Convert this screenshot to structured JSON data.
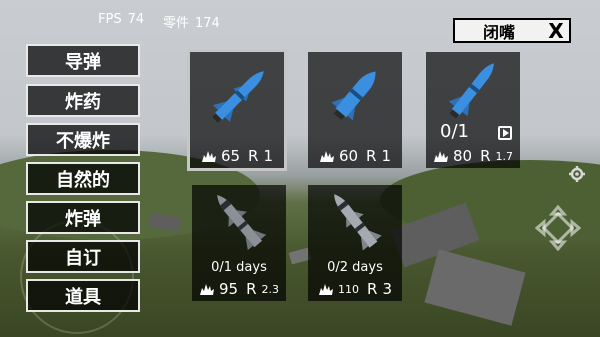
{
  "hud": {
    "fps_label": "FPS",
    "fps_value": "74",
    "parts_label": "零件",
    "parts_value": "174"
  },
  "categories": [
    {
      "label": "导弹",
      "active": false
    },
    {
      "label": "炸药",
      "active": false
    },
    {
      "label": "不爆炸",
      "active": false
    },
    {
      "label": "自然的",
      "active": false
    },
    {
      "label": "炸弹",
      "active": false
    },
    {
      "label": "自订",
      "active": false
    },
    {
      "label": "道具",
      "active": false
    }
  ],
  "close_bar": {
    "label": "闭嘴",
    "close_glyph": "X"
  },
  "weapons": [
    {
      "damage": "65",
      "range_label": "R",
      "range": "1",
      "color": "#3b8fe0",
      "selected": true
    },
    {
      "damage": "60",
      "range_label": "R",
      "range": "1",
      "color": "#3b8fe0"
    },
    {
      "damage": "80",
      "range_label": "R",
      "range": "1.7",
      "count": "0/1",
      "icon": "video-ad-icon",
      "color": "#3b8fe0"
    },
    {
      "damage": "95",
      "range_label": "R",
      "range": "2.3",
      "days": "0/1 days",
      "color": "#8a9096"
    },
    {
      "damage": "110",
      "range_label": "R",
      "range": "3",
      "days": "0/2 days",
      "color": "#a4aab0"
    }
  ],
  "icons": [
    "explosion-icon",
    "gear-icon",
    "move-arrows-icon",
    "close-icon"
  ],
  "colors": {
    "accent_blue": "#3b8fe0",
    "panel_bg": "#000000",
    "button_border": "#e8e8e8"
  }
}
